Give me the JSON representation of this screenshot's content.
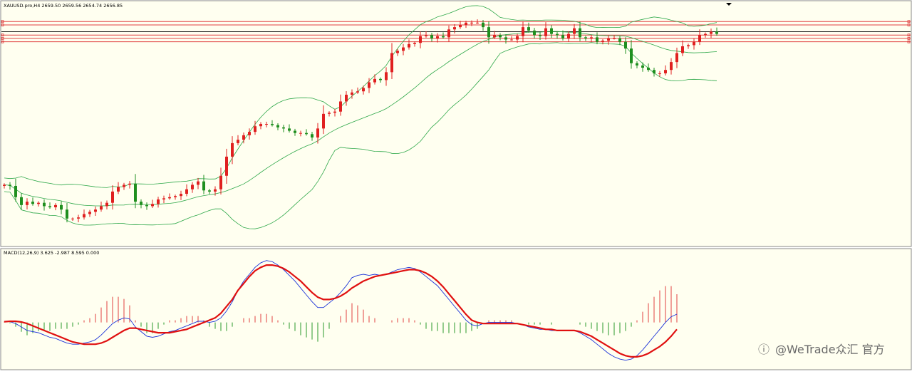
{
  "header": {
    "symbol_info": "XAUUSD.pro,H4  2659.50 2659.56 2654.74 2656.85"
  },
  "macd": {
    "label": "MACD(12,26,9) 3.625 -2.987 8.595 0.000"
  },
  "watermark": {
    "text": "@WeTrade众汇 官方"
  },
  "colors": {
    "bg": "#fffff0",
    "up": "#e02020",
    "down": "#1f8f1f",
    "band": "#2ea84a",
    "level": "#e04040",
    "current": "#1a1a1a",
    "macd_line": "#1c33d8",
    "signal_line": "#e01010",
    "hist_up": "#e04040",
    "hist_down": "#2a9a2a"
  },
  "chart_data": [
    {
      "type": "candlestick",
      "symbol": "XAUUSD.pro",
      "timeframe": "H4",
      "last_bar": {
        "open": 2659.5,
        "high": 2659.56,
        "low": 2654.74,
        "close": 2656.85
      },
      "overlays": [
        "Bollinger Bands"
      ],
      "closes": [
        2586,
        2585,
        2575,
        2568,
        2571,
        2569,
        2570,
        2567,
        2566,
        2568,
        2564,
        2556,
        2556,
        2557,
        2560,
        2562,
        2564,
        2567,
        2570,
        2580,
        2584,
        2586,
        2587,
        2571,
        2568,
        2567,
        2569,
        2573,
        2574,
        2575,
        2576,
        2578,
        2582,
        2586,
        2589,
        2581,
        2580,
        2582,
        2594,
        2611,
        2623,
        2626,
        2630,
        2633,
        2638,
        2640,
        2640,
        2639,
        2637,
        2636,
        2634,
        2632,
        2632,
        2631,
        2628,
        2636,
        2649,
        2650,
        2651,
        2660,
        2666,
        2668,
        2669,
        2672,
        2677,
        2680,
        2679,
        2686,
        2703,
        2705,
        2708,
        2711,
        2712,
        2718,
        2719,
        2716,
        2718,
        2717,
        2724,
        2726,
        2728,
        2730,
        2730,
        2730,
        2726,
        2717,
        2719,
        2717,
        2715,
        2715,
        2718,
        2726,
        2723,
        2719,
        2718,
        2725,
        2720,
        2719,
        2716,
        2720,
        2725,
        2717,
        2716,
        2717,
        2713,
        2714,
        2716,
        2716,
        2713,
        2707,
        2694,
        2692,
        2690,
        2688,
        2685,
        2685,
        2688,
        2695,
        2703,
        2709,
        2710,
        2713,
        2719,
        2720,
        2722,
        2720
      ],
      "horizontal_levels": [
        2731,
        2728,
        2719,
        2716,
        2713
      ],
      "current_level": 2722
    },
    {
      "type": "line",
      "name": "MACD(12,26,9)",
      "values_shown": {
        "macd": 3.625,
        "signal": -2.987,
        "histogram": 8.595,
        "zero": 0.0
      },
      "macd": [
        0.5,
        0.3,
        -0.5,
        -2,
        -3.5,
        -4,
        -4.5,
        -5.5,
        -6.5,
        -7,
        -8,
        -9,
        -9.5,
        -9.5,
        -9,
        -8.5,
        -7.5,
        -5.5,
        -3,
        -0.5,
        1,
        2,
        1.5,
        -2,
        -4,
        -6,
        -6.5,
        -6,
        -5,
        -4,
        -3.5,
        -2.5,
        -1.5,
        -0.5,
        0.5,
        0.5,
        0,
        0.5,
        2,
        5,
        9,
        14,
        18,
        21,
        24,
        26,
        27,
        26.5,
        25,
        23,
        20.5,
        18,
        15,
        12,
        9,
        6.5,
        6.5,
        8.5,
        10.5,
        13,
        16,
        19.5,
        20.5,
        21,
        20.5,
        21,
        20.5,
        21,
        22,
        23,
        23.5,
        24,
        23.5,
        22,
        20,
        18,
        16,
        13,
        10,
        7,
        4,
        1,
        -1,
        -1.5,
        -0.5,
        0,
        0,
        0,
        0,
        0,
        -0.5,
        -1,
        -2,
        -2.5,
        -3,
        -3,
        -3.5,
        -3.5,
        -3.5,
        -3.5,
        -3.5,
        -4.5,
        -6,
        -7.5,
        -9.5,
        -11.5,
        -13.5,
        -15,
        -16,
        -16.5,
        -16,
        -14.5,
        -12,
        -9,
        -6,
        -3,
        0,
        2.5,
        3.6
      ],
      "signal": [
        0.3,
        0.5,
        0.5,
        0.2,
        -0.5,
        -1.5,
        -2.5,
        -3.5,
        -4.5,
        -5.5,
        -6.5,
        -7.5,
        -8.5,
        -9,
        -9.5,
        -9.5,
        -9.5,
        -9,
        -8,
        -6.5,
        -5,
        -3.5,
        -2.5,
        -2.5,
        -3,
        -3.5,
        -4,
        -4.5,
        -4.5,
        -4.5,
        -4,
        -3.5,
        -3,
        -2,
        -1,
        0,
        1,
        2,
        4,
        7,
        10,
        14,
        17,
        20,
        22.5,
        24,
        25,
        25,
        24.5,
        23.5,
        22,
        20,
        18,
        15.5,
        13,
        11,
        10,
        10,
        10.5,
        11.5,
        13,
        15,
        16.5,
        18,
        19,
        20,
        20.5,
        21,
        21.5,
        22,
        22.5,
        23,
        23,
        22.5,
        21.5,
        20,
        18,
        15.5,
        12.5,
        9.5,
        6.5,
        3.5,
        1,
        0,
        -0.5,
        -0.5,
        -0.5,
        -0.5,
        -0.5,
        -0.5,
        -0.5,
        -1,
        -1.5,
        -2,
        -2.5,
        -3,
        -3,
        -3.5,
        -3.5,
        -3.5,
        -3.5,
        -4,
        -5,
        -6,
        -7.5,
        -9,
        -10.5,
        -12,
        -13.5,
        -14.5,
        -15,
        -15,
        -14.5,
        -13.5,
        -12,
        -10.5,
        -8.5,
        -6,
        -3
      ]
    }
  ]
}
